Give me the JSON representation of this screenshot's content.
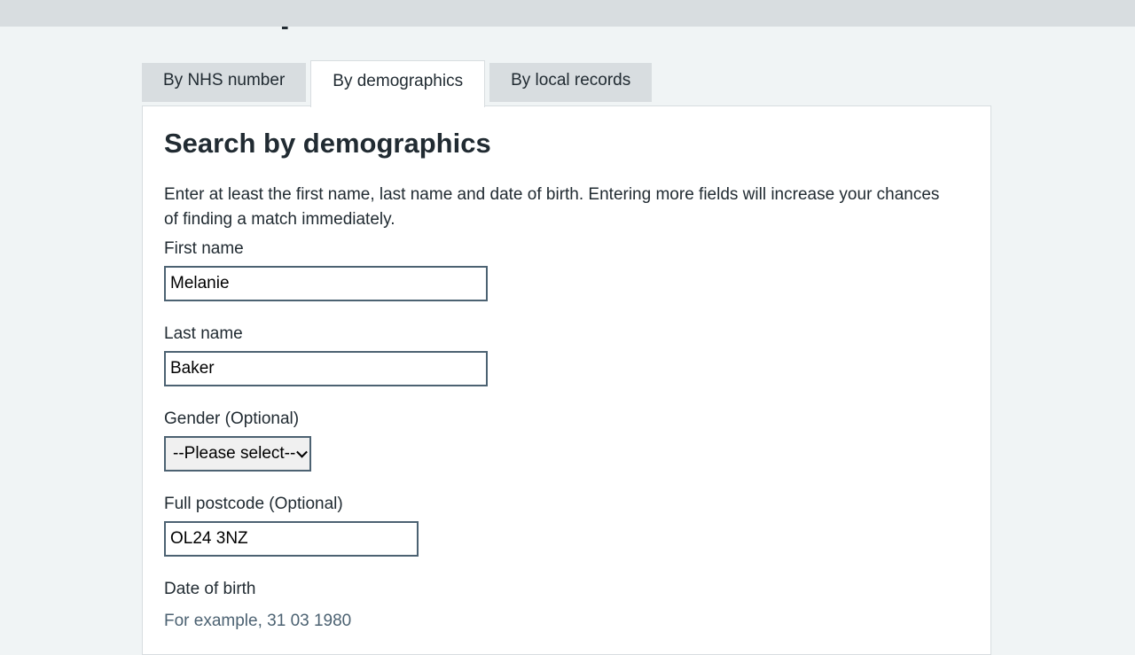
{
  "page": {
    "title": "Find a patient"
  },
  "tabs": [
    {
      "label": "By NHS number",
      "active": false
    },
    {
      "label": "By demographics",
      "active": true
    },
    {
      "label": "By local records",
      "active": false
    }
  ],
  "panel": {
    "heading": "Search by demographics",
    "intro": "Enter at least the first name, last name and date of birth. Entering more fields will increase your chances of finding a match immediately."
  },
  "form": {
    "first_name": {
      "label": "First name",
      "value": "Melanie"
    },
    "last_name": {
      "label": "Last name",
      "value": "Baker"
    },
    "gender": {
      "label": "Gender (Optional)",
      "selected": "--Please select--"
    },
    "postcode": {
      "label": "Full postcode (Optional)",
      "value": "OL24 3NZ"
    },
    "dob": {
      "label": "Date of birth",
      "hint": "For example, 31 03 1980"
    }
  },
  "colors": {
    "background": "#f0f4f5",
    "tab_inactive": "#d8dde0",
    "text": "#212b32",
    "input_border": "#4c6272",
    "hint": "#4c6272"
  }
}
